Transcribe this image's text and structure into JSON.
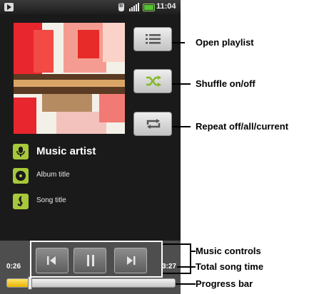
{
  "status_bar": {
    "time": "11:04"
  },
  "now_playing": {
    "artist": "Music artist",
    "album": "Album title",
    "song": "Song title"
  },
  "side_buttons": {
    "playlist_icon": "list-icon",
    "shuffle_icon": "shuffle-icon",
    "repeat_icon": "repeat-icon"
  },
  "playback": {
    "elapsed": "0:26",
    "total": "3:27",
    "progress": 0.126
  },
  "callouts": {
    "open_playlist": "Open playlist",
    "shuffle": "Shuffle on/off",
    "repeat": "Repeat off/all/current",
    "music_controls": "Music controls",
    "total_song_time": "Total song time",
    "progress_bar": "Progress bar"
  },
  "colors": {
    "accent_green": "#a7c83a",
    "progress_yellow": "#f5c800",
    "screen_bg": "#1a1a1a"
  }
}
